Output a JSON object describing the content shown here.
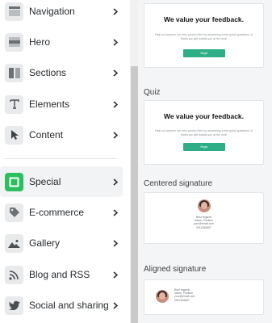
{
  "menu": {
    "items": [
      {
        "label": "Navigation",
        "icon": "navigation-icon"
      },
      {
        "label": "Hero",
        "icon": "hero-icon"
      },
      {
        "label": "Sections",
        "icon": "sections-icon"
      },
      {
        "label": "Elements",
        "icon": "text-t-icon"
      },
      {
        "label": "Content",
        "icon": "cursor-icon"
      },
      {
        "label": "Special",
        "icon": "special-icon",
        "active": true
      },
      {
        "label": "E-commerce",
        "icon": "tag-icon"
      },
      {
        "label": "Gallery",
        "icon": "image-icon"
      },
      {
        "label": "Blog and RSS",
        "icon": "rss-icon"
      },
      {
        "label": "Social and sharing",
        "icon": "twitter-icon"
      }
    ],
    "accent": "#2bbf5e"
  },
  "preview": {
    "feedback_card": {
      "heading": "We value your feedback.",
      "text": "Help us improve our new product line by answering a few quick questions. A thank you gift awaits you at the end!",
      "button": "Begin",
      "button_color": "#2eae86"
    },
    "quiz": {
      "title": "Quiz",
      "heading": "We value your feedback.",
      "text": "Help us improve our new product line by answering a few quick questions. A thank you gift awaits you at the end!",
      "button": "Begin"
    },
    "centered_signature": {
      "title": "Centered signature",
      "lines": [
        "Best regards",
        "Name, Position",
        "your@email.com",
        "0912345687"
      ]
    },
    "aligned_signature": {
      "title": "Aligned signature",
      "lines": [
        "Best regards",
        "Name, Position",
        "your@email.com",
        "0912345687"
      ]
    }
  }
}
